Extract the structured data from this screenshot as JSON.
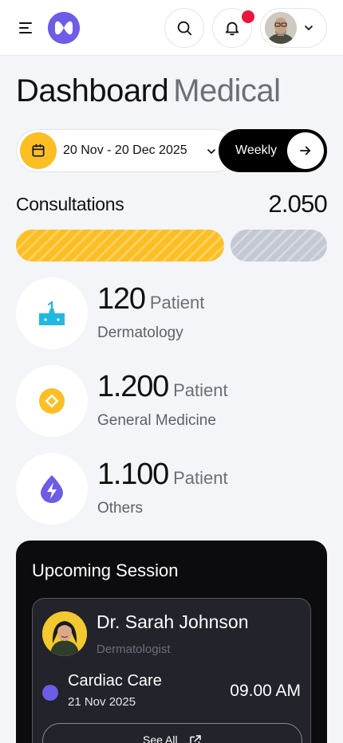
{
  "header": {
    "menu_icon": "hamburger-menu-icon",
    "logo_icon": "app-logo-icon",
    "search_icon": "search-icon",
    "notification_icon": "bell-icon",
    "profile_chevron": "chevron-down-icon"
  },
  "title": {
    "primary": "Dashboard",
    "secondary": "Medical"
  },
  "date_range": {
    "label": "20 Nov - 20 Dec 2025",
    "icon": "calendar-icon"
  },
  "period": {
    "label": "Weekly",
    "icon": "arrow-right-icon"
  },
  "consultations": {
    "label": "Consultations",
    "value": "2.050",
    "progress_fraction": 0.67
  },
  "stats": [
    {
      "value": "120",
      "unit": "Patient",
      "name": "Dermatology",
      "icon": "skin-care-icon",
      "color": "#22b8e0"
    },
    {
      "value": "1.200",
      "unit": "Patient",
      "name": "General Medicine",
      "icon": "diamond-badge-icon",
      "color": "#fbbf24"
    },
    {
      "value": "1.100",
      "unit": "Patient",
      "name": "Others",
      "icon": "lightning-drop-icon",
      "color": "#6c5ce7"
    }
  ],
  "upcoming": {
    "title": "Upcoming Session",
    "doctor": {
      "name": "Dr. Sarah Johnson",
      "specialty": "Dermatologist"
    },
    "session": {
      "name": "Cardiac Care",
      "date": "21 Nov 2025",
      "time": "09.00 AM"
    },
    "see_all_label": "See All"
  },
  "colors": {
    "accent": "#6c5ce7",
    "yellow": "#fbbf24",
    "notification": "#e8173c",
    "dark": "#0c0c0f"
  }
}
